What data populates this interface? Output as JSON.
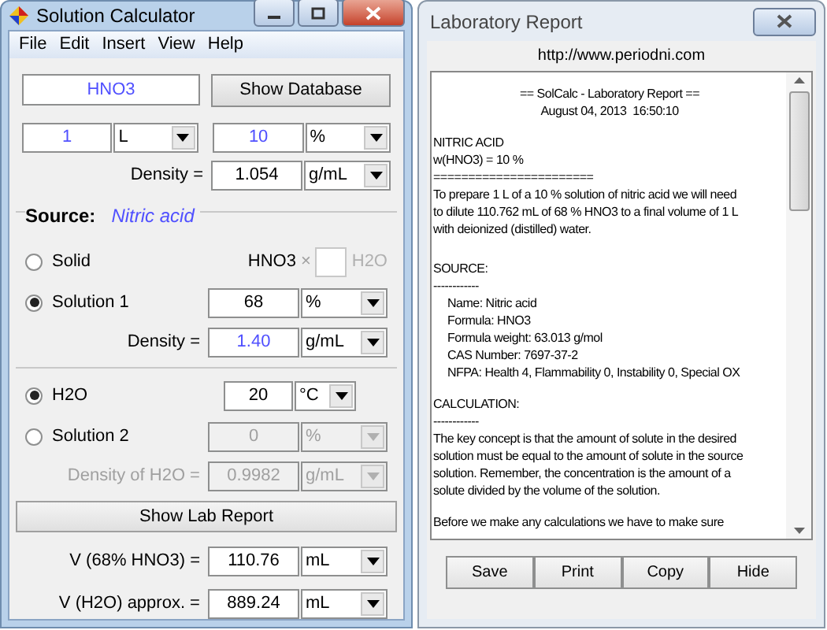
{
  "calculator": {
    "title": "Solution Calculator",
    "menu": [
      "File",
      "Edit",
      "Insert",
      "View",
      "Help"
    ],
    "compound": {
      "value": "HNO3",
      "user_input": true
    },
    "show_database": "Show Database",
    "volume": {
      "value": "1",
      "user_input": true
    },
    "volume_unit": "L",
    "concentration": {
      "value": "10",
      "user_input": true
    },
    "concentration_unit": "%",
    "density_label": "Density =",
    "density": {
      "value": "1.054",
      "user_input": false
    },
    "density_unit": "g/mL",
    "source_label": "Source:",
    "source_name": "Nitric acid",
    "sources": [
      {
        "label": "Solid",
        "selected": false,
        "formula": "HNO3",
        "times": "×",
        "water": "H2O"
      },
      {
        "label": "Solution 1",
        "selected": true,
        "value": {
          "value": "68",
          "user_input": false
        },
        "unit": "%",
        "density_label": "Density =",
        "density": {
          "value": "1.40",
          "user_input": true
        },
        "density_unit": "g/mL"
      }
    ],
    "diluents": [
      {
        "label": "H2O",
        "selected": true,
        "value": "20",
        "unit": "°C"
      },
      {
        "label": "Solution 2",
        "selected": false,
        "disabled": true,
        "value": "0",
        "unit": "%",
        "density_label": "Density of H2O =",
        "density": "0.9982",
        "density_unit": "g/mL"
      }
    ],
    "show_lab_report": "Show Lab Report",
    "results": [
      {
        "label": "V (68% HNO3) =",
        "value": "110.76",
        "unit": "mL"
      },
      {
        "label": "V (H2O) approx. =",
        "value": "889.24",
        "unit": "mL"
      }
    ]
  },
  "report": {
    "title": "Laboratory Report",
    "url": "http://www.periodni.com",
    "blocks": [
      {
        "kind": "center",
        "lines": [
          "== SolCalc - Laboratory Report ==",
          "August 04, 2013  16:50:10"
        ]
      },
      {
        "kind": "plain",
        "lines": [
          "NITRIC ACID",
          "w(HNO3) = 10 %",
          "=======================",
          "To prepare 1 L of a 10 % solution of nitric acid we will need",
          "to dilute 110.762 mL of 68 % HNO3 to a final volume of 1 L",
          "with deionized (distilled) water."
        ]
      },
      {
        "kind": "section",
        "lines": [
          "SOURCE:",
          "------------"
        ]
      },
      {
        "kind": "indent",
        "lines": [
          "Name: Nitric acid",
          "Formula: HNO3",
          "Formula weight: 63.013 g/mol",
          "CAS Number: 7697-37-2",
          "NFPA: Health 4, Flammability 0, Instability 0, Special OX"
        ]
      },
      {
        "kind": "plain",
        "lines": [
          "CALCULATION:",
          "------------",
          "The key concept is that the amount of solute in the desired",
          "solution must be equal to the amount of solute in the source",
          "solution. Remember, the concentration is the amount of a",
          "solute divided by the volume of the solution."
        ]
      },
      {
        "kind": "plain",
        "lines": [
          "Before we make any calculations we have to make sure"
        ]
      }
    ],
    "buttons": [
      "Save",
      "Print",
      "Copy",
      "Hide"
    ]
  }
}
